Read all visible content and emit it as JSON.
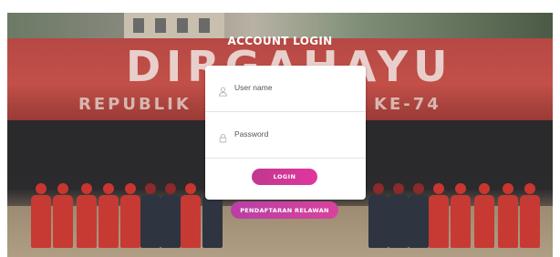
{
  "page": {
    "title": "ACCOUNT LOGIN"
  },
  "background": {
    "banner_main": "DIRGAHAYU",
    "banner_left": "REPUBLIK",
    "banner_right": "KE-74"
  },
  "form": {
    "username_placeholder": "User name",
    "username_value": "",
    "username_icon": "user-icon",
    "password_placeholder": "Password",
    "password_value": "",
    "password_icon": "lock-icon",
    "login_label": "LOGIN",
    "register_label": "PENDAFTARAN RELAWAN"
  },
  "colors": {
    "accent": "#d8369a",
    "card": "#ffffff"
  }
}
